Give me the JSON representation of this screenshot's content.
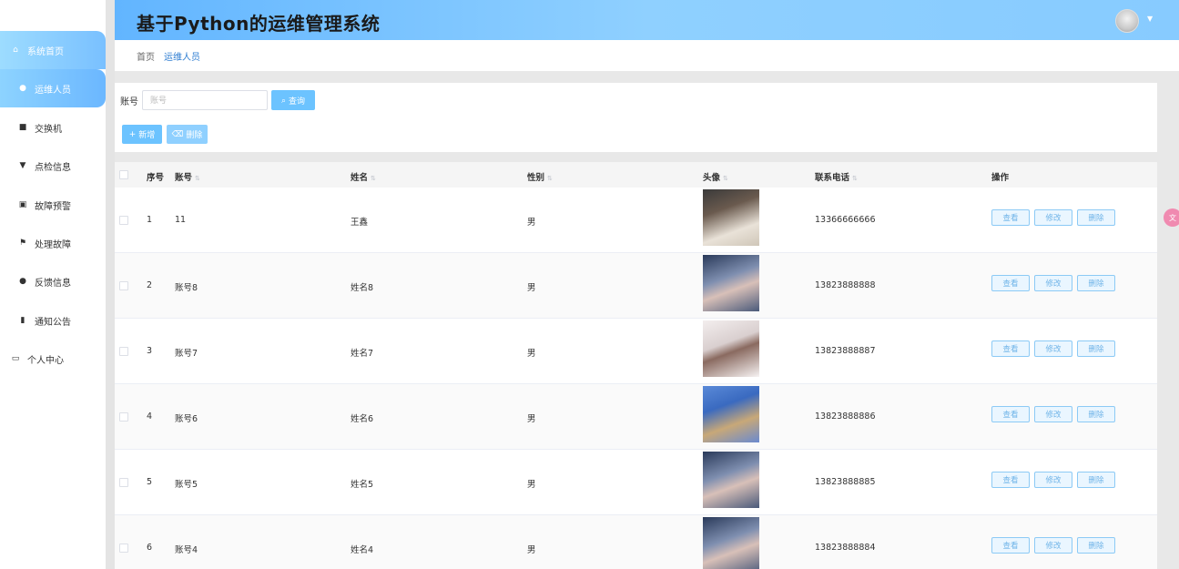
{
  "header": {
    "title": "基于Python的运维管理系统"
  },
  "sidebar": {
    "items": [
      {
        "label": "系统首页",
        "icon": "home-icon"
      },
      {
        "label": "运维人员",
        "icon": "user-icon"
      },
      {
        "label": "交换机",
        "icon": "briefcase-icon"
      },
      {
        "label": "点检信息",
        "icon": "pin-icon"
      },
      {
        "label": "故障预警",
        "icon": "chart-icon"
      },
      {
        "label": "处理故障",
        "icon": "flag-icon"
      },
      {
        "label": "反馈信息",
        "icon": "location-icon"
      },
      {
        "label": "通知公告",
        "icon": "clipboard-icon"
      },
      {
        "label": "个人中心",
        "icon": "window-icon"
      }
    ]
  },
  "breadcrumb": {
    "home": "首页",
    "current": "运维人员"
  },
  "search": {
    "label": "账号",
    "placeholder": "账号",
    "value": "",
    "button": "查询"
  },
  "toolbar": {
    "add": "新增",
    "delete": "删除"
  },
  "table": {
    "headers": {
      "index": "序号",
      "account": "账号",
      "name": "姓名",
      "gender": "性别",
      "avatar": "头像",
      "phone": "联系电话",
      "ops": "操作"
    },
    "op_labels": {
      "view": "查看",
      "edit": "修改",
      "delete": "删除"
    },
    "rows": [
      {
        "index": "1",
        "account": "11",
        "name": "王鑫",
        "gender": "男",
        "phone": "13366666666"
      },
      {
        "index": "2",
        "account": "账号8",
        "name": "姓名8",
        "gender": "男",
        "phone": "13823888888"
      },
      {
        "index": "3",
        "account": "账号7",
        "name": "姓名7",
        "gender": "男",
        "phone": "13823888887"
      },
      {
        "index": "4",
        "account": "账号6",
        "name": "姓名6",
        "gender": "男",
        "phone": "13823888886"
      },
      {
        "index": "5",
        "account": "账号5",
        "name": "姓名5",
        "gender": "男",
        "phone": "13823888885"
      },
      {
        "index": "6",
        "account": "账号4",
        "name": "姓名4",
        "gender": "男",
        "phone": "13823888884"
      }
    ]
  },
  "colors": {
    "accent": "#6cc3ff",
    "header_gradient_start": "#62b5ff",
    "header_gradient_end": "#8fd0ff",
    "link": "#2e7dd1"
  }
}
